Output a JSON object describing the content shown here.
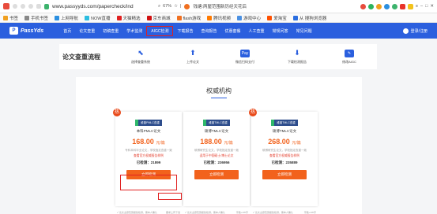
{
  "browser": {
    "url": "www.passyyds.com/papercheck/ind",
    "zoom": "67%",
    "notice": "钱塘:两屋范围新历经天花后"
  },
  "bookmarks": {
    "items": [
      {
        "label": "书签",
        "color": "#f0a020"
      },
      {
        "label": "手机书签",
        "color": "#888888"
      },
      {
        "label": "上网导航",
        "color": "#2b8fe0"
      },
      {
        "label": "NOW直播",
        "color": "#2bbde0"
      },
      {
        "label": "天猫精选",
        "color": "#e02020"
      },
      {
        "label": "京东商城",
        "color": "#d01010"
      },
      {
        "label": "flash游戏",
        "color": "#f07020"
      },
      {
        "label": "腾讯视频",
        "color": "#ff7a00"
      },
      {
        "label": "游戏中心",
        "color": "#4a90e2"
      },
      {
        "label": "爱淘宝",
        "color": "#ff5000"
      },
      {
        "label": "从 搜狗浏览器",
        "color": "#2b6ee0"
      }
    ]
  },
  "nav": {
    "logo": "PassYds",
    "items": [
      "首页",
      "论文查重",
      "初稿查重",
      "学术监测",
      "AIGC检测",
      "下载报告",
      "查询报告",
      "优惠套餐",
      "人工查重",
      "常规问答",
      "常见问题"
    ],
    "login": "登录/注册"
  },
  "steps": {
    "title": "论文查重流程",
    "items": [
      {
        "label": "选择查重系统",
        "glyph": "⬉"
      },
      {
        "label": "上传论文",
        "glyph": "⬆"
      },
      {
        "label": "微信扫码支付",
        "glyph": "Pay"
      },
      {
        "label": "下载检测报告",
        "glyph": "⬇"
      },
      {
        "label": "修改AIGC",
        "glyph": "✎"
      }
    ]
  },
  "section": {
    "title": "权威机构"
  },
  "cards": [
    {
      "badge": "热",
      "logo": "维普PMLC查重",
      "name": "本科PMLC论文",
      "price": "168.00",
      "unit": "元/篇",
      "desc": "专科本科毕业论文，学校指定查重一致",
      "link": "查看官方权威报告样例",
      "used": "已检测：21899",
      "button": "立即检测",
      "footer_left": "✓ 论文主题范围报告检测，需本人确认",
      "footer_right": "要求上传下载"
    },
    {
      "badge": "",
      "logo": "维普TMLC查重",
      "name": "硕博TMLC论文",
      "price": "188.00",
      "unit": "元/篇",
      "desc": "硕博研究生论文，学校指定查重一致",
      "link": "适用于中国硕士/博士论文",
      "used": "已检测：236956",
      "button": "立即检测",
      "footer_left": "✓ 论文主题范围报告检测，需本人确认",
      "footer_right": "字数+1W字"
    },
    {
      "badge": "热",
      "logo": "维普TMLC查重",
      "name": "硕博TMLC论文",
      "price": "268.00",
      "unit": "元/篇",
      "desc": "硕博研究生论文，学校指定查重一致",
      "link": "查看官方权威报告样例",
      "used": "已检测：235889",
      "button": "立即检测",
      "footer_left": "✓ 论文主题范围报告检测，需本人确认",
      "footer_right": "字数+1W字"
    }
  ]
}
